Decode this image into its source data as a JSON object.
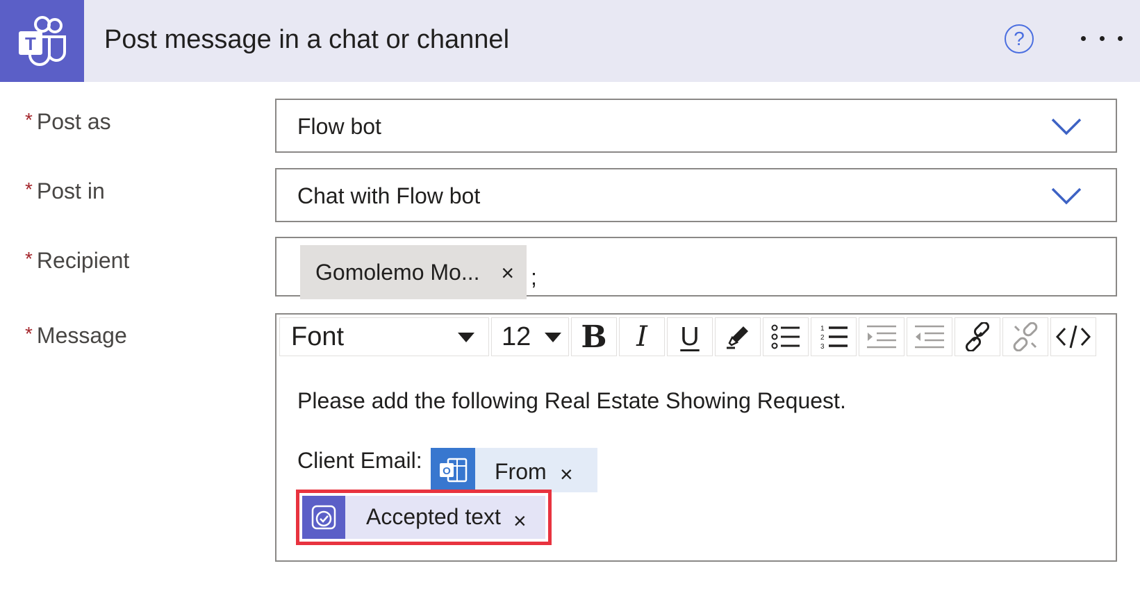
{
  "header": {
    "title": "Post message in a chat or channel",
    "help_label": "?",
    "app_icon": "teams-icon",
    "accent": "#5b5fc7"
  },
  "fields": {
    "post_as": {
      "label": "Post as",
      "required_mark": "*",
      "value": "Flow bot"
    },
    "post_in": {
      "label": "Post in",
      "required_mark": "*",
      "value": "Chat with Flow bot"
    },
    "recipient": {
      "label": "Recipient",
      "required_mark": "*",
      "token": "Gomolemo Mo...",
      "separator": ";"
    },
    "message": {
      "label": "Message",
      "required_mark": "*"
    }
  },
  "toolbar": {
    "font_label": "Font",
    "size_label": "12",
    "bold": "B",
    "italic": "I",
    "underline": "U",
    "icons": [
      "highlight-pen-icon",
      "bullet-list-icon",
      "numbered-list-icon",
      "increase-indent-icon",
      "decrease-indent-icon",
      "link-icon",
      "unlink-icon",
      "code-view-icon"
    ]
  },
  "message_body": {
    "line1": "Please add the following Real Estate Showing Request.",
    "client_email_label": "Client Email:",
    "tokens": [
      {
        "label": "From",
        "icon": "outlook-icon",
        "color": "#3877cf"
      },
      {
        "label": "Accepted text",
        "icon": "approvals-icon",
        "color": "#5b5fc7",
        "highlighted": true,
        "highlight_color": "#e8333f"
      }
    ],
    "remove_symbol": "×"
  }
}
